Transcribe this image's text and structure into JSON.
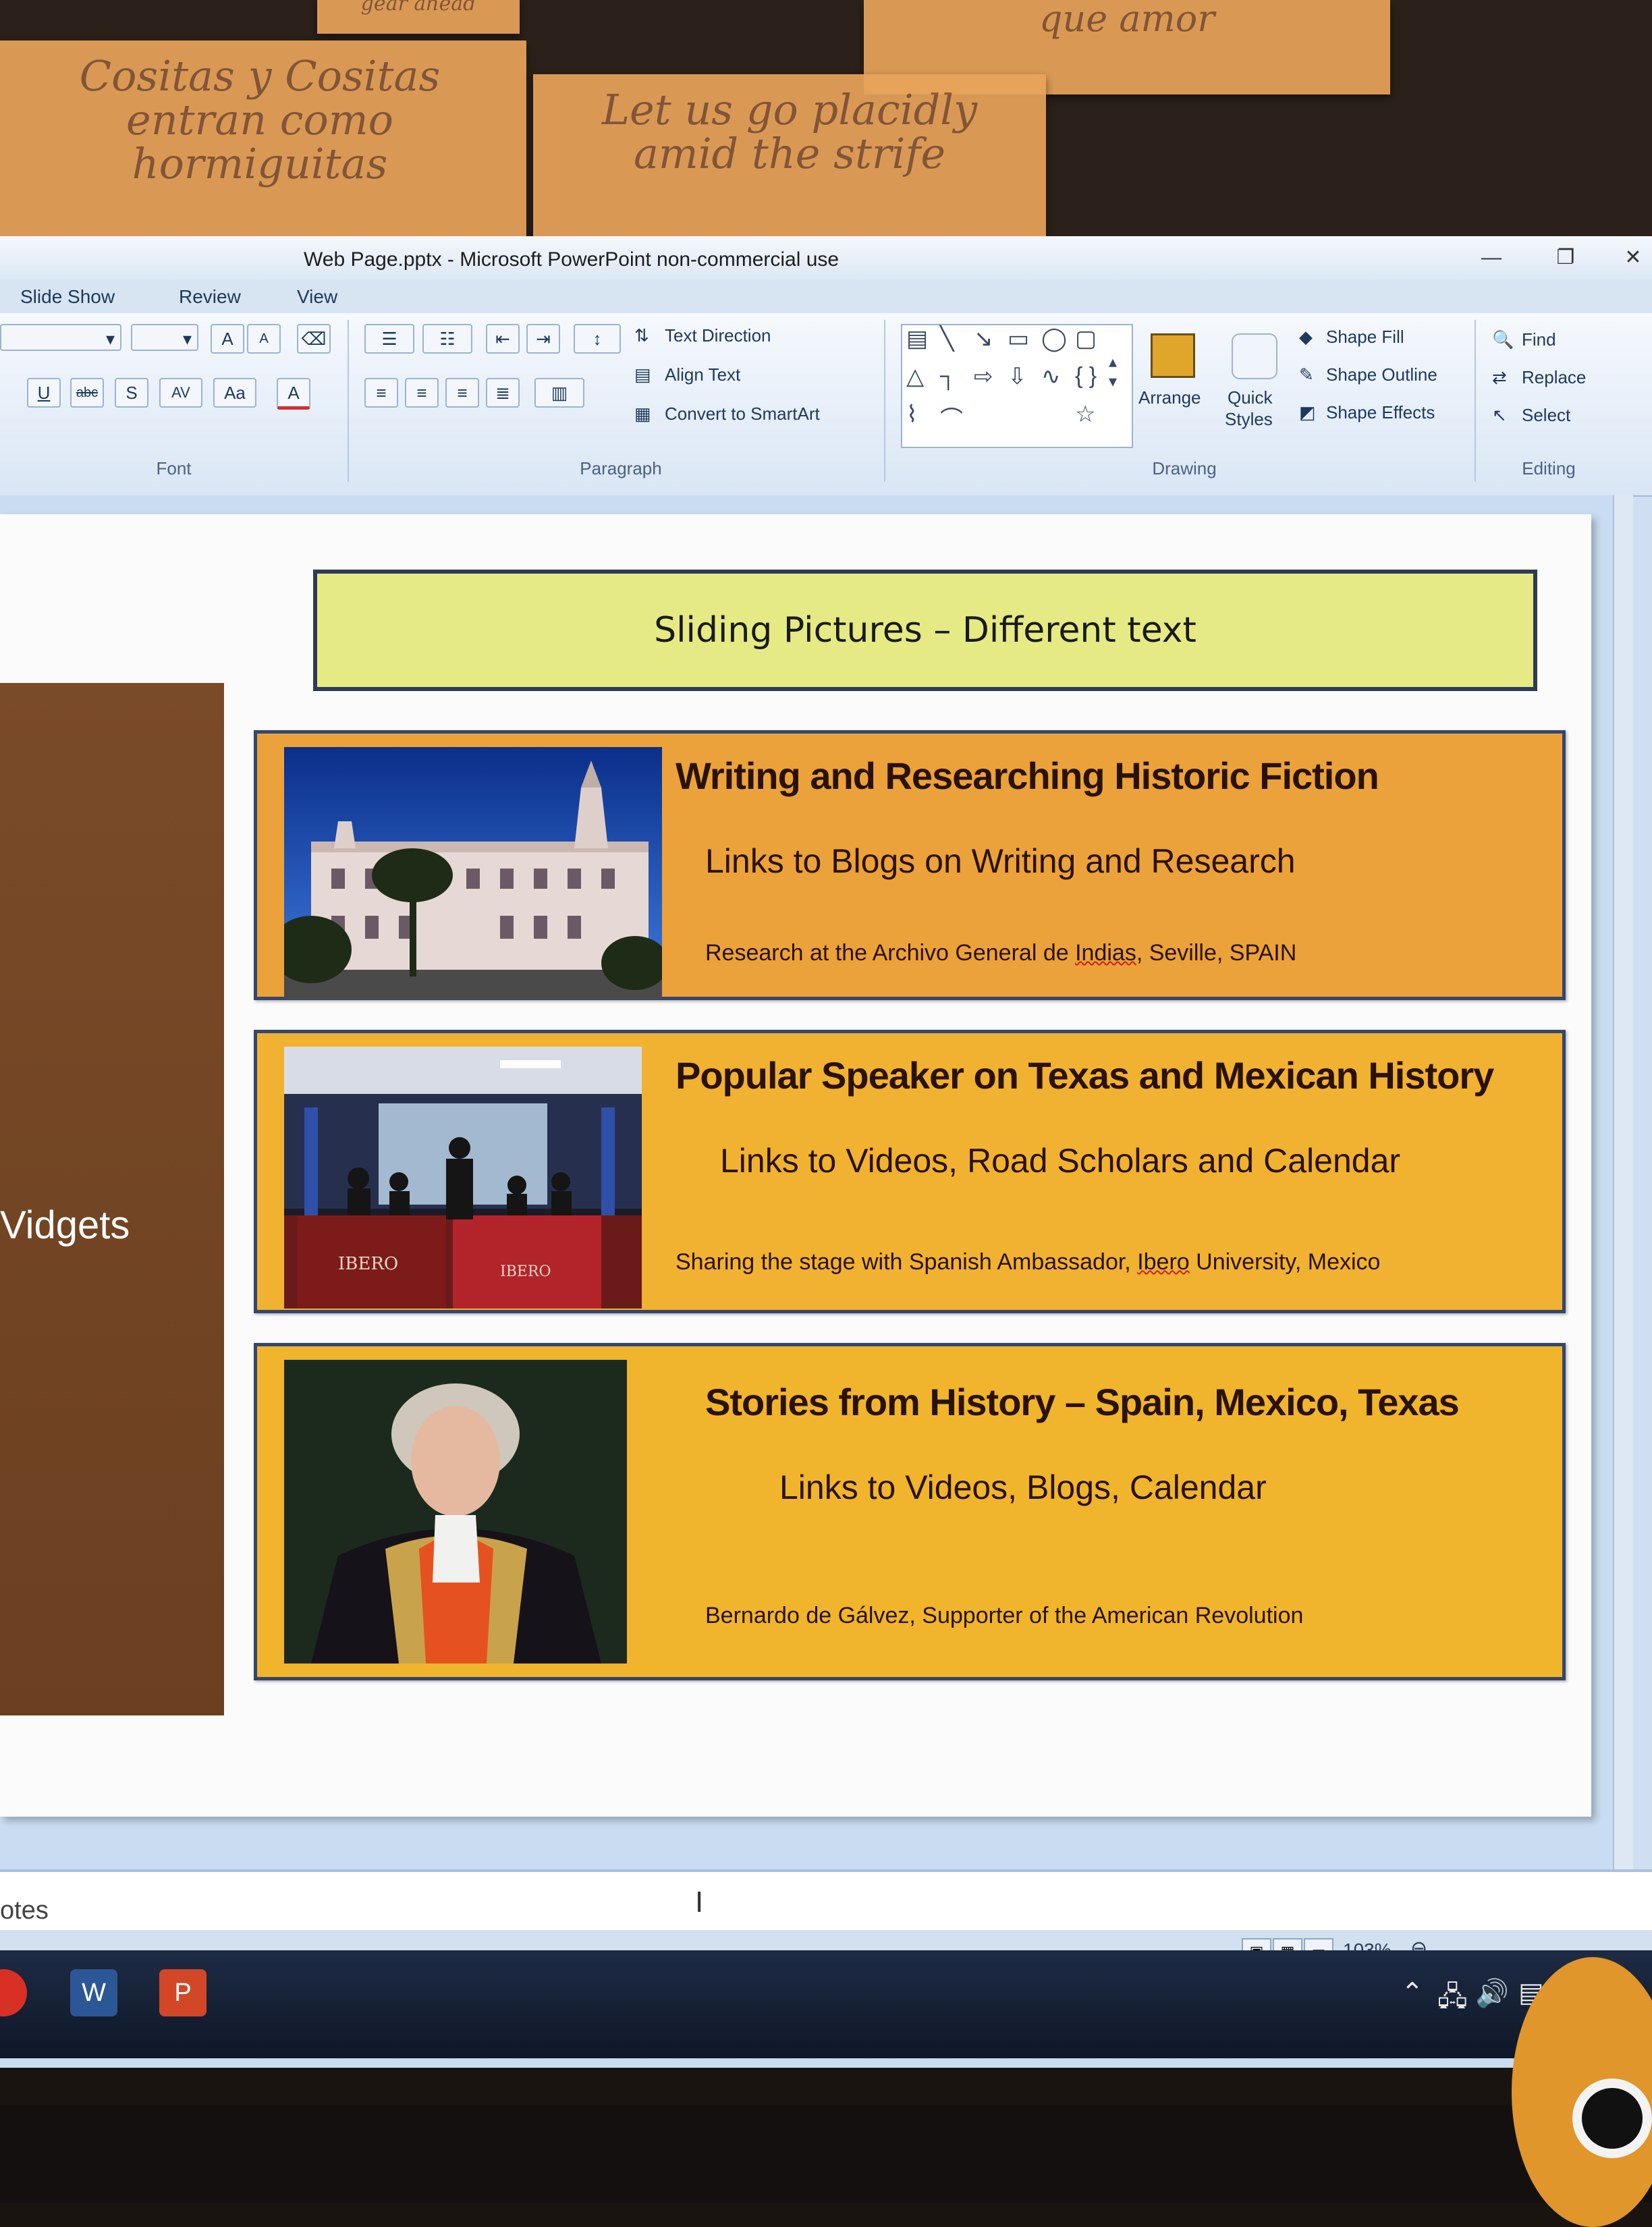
{
  "notes": {
    "note1": "Cositas y Cositas\nentran como\nhormiguitas",
    "note2": "Let us go placidly\namid the strife",
    "note3": "gear ahead",
    "note4": "que amor"
  },
  "window": {
    "title": "Web Page.pptx - Microsoft PowerPoint non-commercial use",
    "minimize": "—",
    "restore": "❐",
    "close": "✕"
  },
  "tabs": [
    "Slide Show",
    "Review",
    "View"
  ],
  "ribbon": {
    "font": {
      "label": "Font",
      "grow": "A",
      "shrink": "A",
      "underline": "U",
      "strike": "abc",
      "shadow": "S",
      "spacing": "AV",
      "case": "Aa",
      "color": "A"
    },
    "paragraph": {
      "label": "Paragraph",
      "text_direction": "Text Direction",
      "align_text": "Align Text",
      "convert": "Convert to SmartArt"
    },
    "drawing": {
      "label": "Drawing",
      "arrange": "Arrange",
      "quick_styles_1": "Quick",
      "quick_styles_2": "Styles",
      "shape_fill": "Shape Fill",
      "shape_outline": "Shape Outline",
      "shape_effects": "Shape Effects"
    },
    "editing": {
      "label": "Editing",
      "find": "Find",
      "replace": "Replace",
      "select": "Select"
    }
  },
  "slide": {
    "left_panel_text": "Vidgets",
    "title_box": "Sliding Pictures – Different text",
    "cards": [
      {
        "heading": "Writing and Researching Historic Fiction",
        "links": "Links to Blogs on Writing and Research",
        "caption_pre": "Research at the Archivo General de ",
        "caption_err": "Indias",
        "caption_post": ", Seville, SPAIN",
        "bg": "#eba23a"
      },
      {
        "heading": "Popular Speaker on Texas and Mexican History",
        "links": "Links to Videos, Road Scholars and Calendar",
        "caption_pre": "Sharing the stage with Spanish Ambassador, ",
        "caption_err": "Ibero",
        "caption_post": " University, Mexico",
        "bg": "#f1b232",
        "photo_banner_1": "IBERO",
        "photo_banner_2": "IBERO"
      },
      {
        "heading": "Stories from History – Spain, Mexico, Texas",
        "links": "Links to Videos, Blogs, Calendar",
        "caption": "Bernardo de Gálvez, Supporter of the American Revolution",
        "bg": "#f0b52c"
      }
    ]
  },
  "notes_pane": {
    "label": "otes"
  },
  "status": {
    "zoom": "103%"
  },
  "colors": {
    "title_box_fill": "#e6ea84",
    "left_panel": "#6f4222",
    "card_border": "#33466f"
  }
}
